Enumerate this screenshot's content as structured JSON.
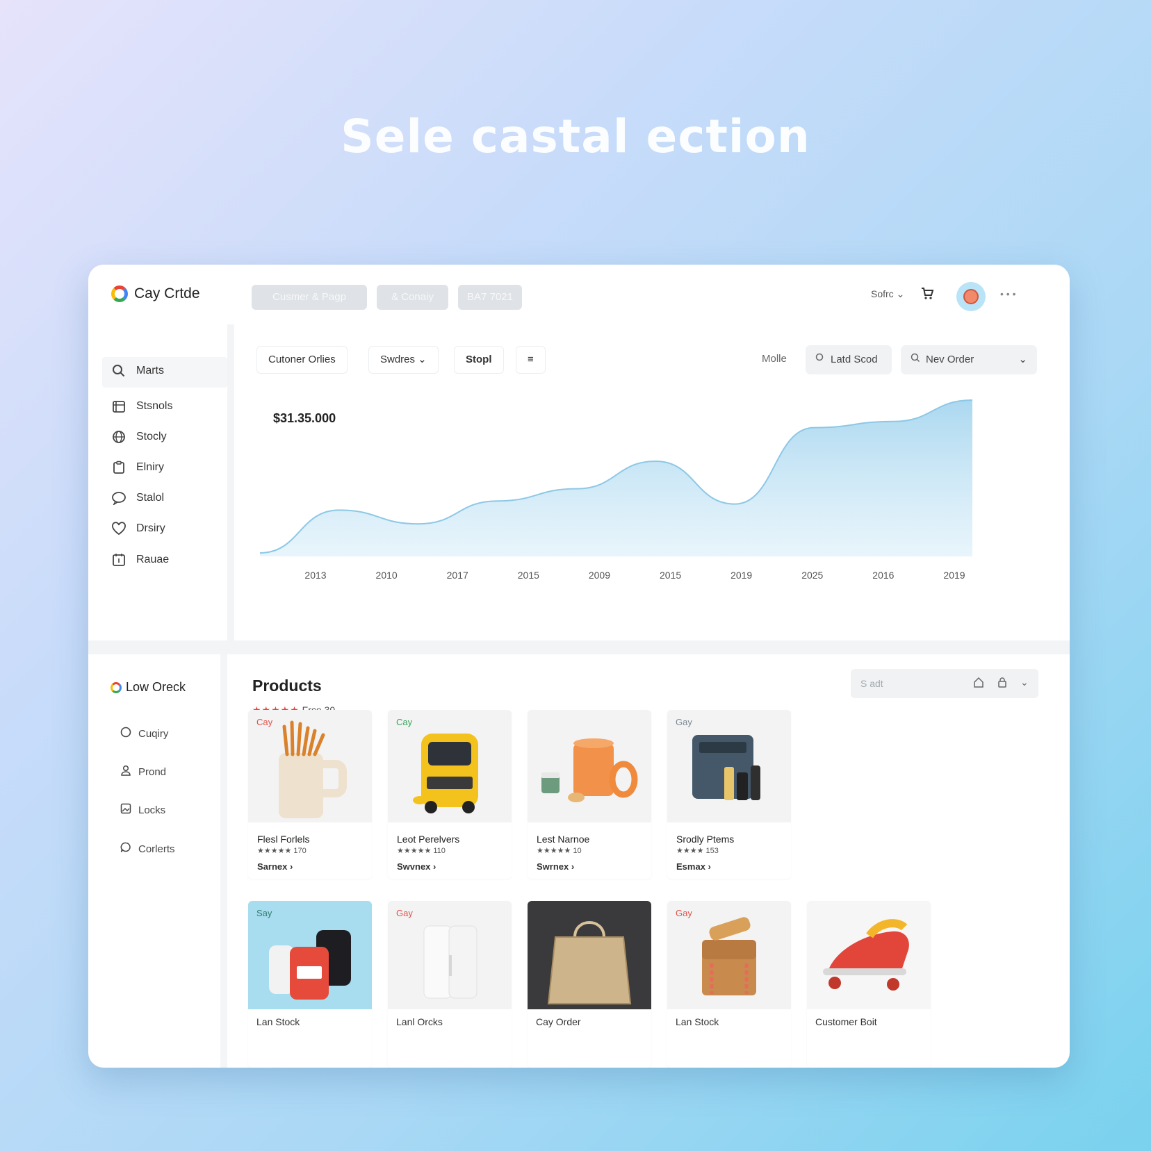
{
  "hero": {
    "title": "Sele castal ection"
  },
  "app": {
    "name": "Cay Crtde"
  },
  "top_pills": [
    "Cusmer   & Pagp",
    "& Conaiy",
    "BA7 7021"
  ],
  "top_right": {
    "selector": "Sofrc ⌄",
    "dots": "• • •"
  },
  "sidebar": {
    "items": [
      {
        "label": "Marts",
        "icon": "search-icon"
      },
      {
        "label": "Stsnols",
        "icon": "store-icon"
      },
      {
        "label": "Stocly",
        "icon": "globe-icon"
      },
      {
        "label": "Elniry",
        "icon": "clipboard-icon"
      },
      {
        "label": "Stalol",
        "icon": "chat-icon"
      },
      {
        "label": "Drsiry",
        "icon": "heart-icon"
      },
      {
        "label": "Rauae",
        "icon": "calendar-icon"
      }
    ]
  },
  "chart_toolbar": {
    "chips": [
      "Cutoner Orlies",
      "Swdres ⌄",
      "Stopl",
      "≡"
    ],
    "mode": "Molle",
    "search1": "Latd Scod",
    "search2": "Nev Order"
  },
  "chart_data": {
    "type": "area",
    "title": "$31.35.000",
    "x": [
      "2013",
      "2010",
      "2017",
      "2015",
      "2009",
      "2015",
      "2019",
      "2025",
      "2016",
      "2019"
    ],
    "series": [
      {
        "values": [
          0.0,
          0.28,
          0.19,
          0.34,
          0.42,
          0.6,
          0.32,
          0.82,
          0.86,
          1.0
        ]
      }
    ],
    "grid": false,
    "legend": "none",
    "color": "#8cc8e6"
  },
  "sidebar2": {
    "title": "Low Oreck",
    "items": [
      {
        "label": "Cuqiry",
        "icon": "circle-icon"
      },
      {
        "label": "Prond",
        "icon": "user-icon"
      },
      {
        "label": "Locks",
        "icon": "image-icon"
      },
      {
        "label": "Corlerts",
        "icon": "comment-icon"
      }
    ]
  },
  "products": {
    "title": "Products",
    "stars": "★★★★★",
    "rating_text": "Frce 30",
    "search_placeholder": "S adt",
    "cards": [
      {
        "badge": "Cay",
        "badge_color": "#e0524a",
        "name": "Flesl Forlels",
        "rating": "★★★★★ 170",
        "shop": "Sarnex ›"
      },
      {
        "badge": "Cay",
        "badge_color": "#3aa35b",
        "name": "Leot Perelvers",
        "rating": "★★★★★ 110",
        "shop": "Swvnex ›"
      },
      {
        "badge": "",
        "badge_color": "#e0524a",
        "name": "Lest Narnoe",
        "rating": "★★★★★ 10",
        "shop": "Swrnex ›"
      },
      {
        "badge": "Gay",
        "badge_color": "#7b8894",
        "name": "Srodly Ptems",
        "rating": "★★★★ 153",
        "shop": "Esmax ›"
      }
    ],
    "cards2": [
      {
        "badge": "Say",
        "badge_color": "#2e7d6e",
        "name": "Lan Stock"
      },
      {
        "badge": "Gay",
        "badge_color": "#e0524a",
        "name": "Lanl Orcks"
      },
      {
        "badge": "",
        "badge_color": "#e0524a",
        "name": "Cay Order"
      },
      {
        "badge": "Gay",
        "badge_color": "#e0524a",
        "name": "Lan Stock"
      },
      {
        "badge": "",
        "badge_color": "#e0524a",
        "name": "Customer Boit"
      }
    ]
  }
}
